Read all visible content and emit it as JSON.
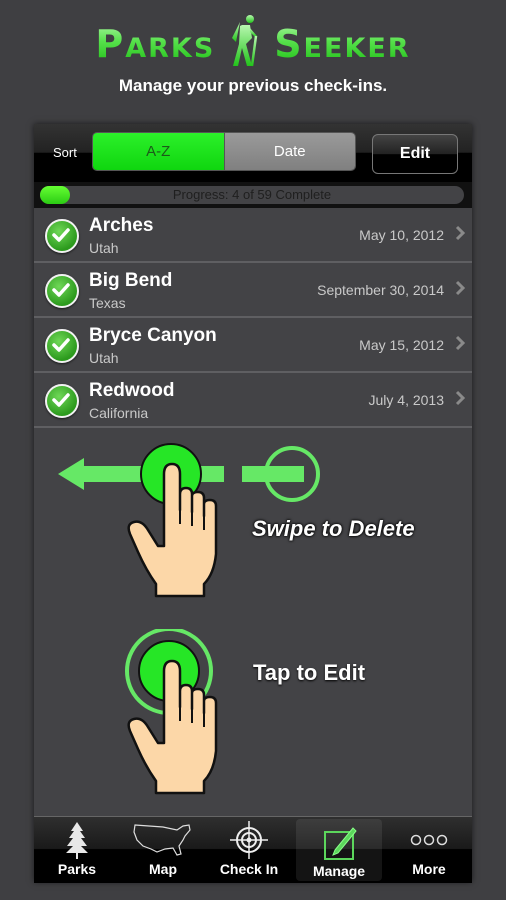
{
  "app": {
    "brand_left": "Parks",
    "brand_right": "Seeker",
    "subtitle": "Manage your previous check-ins."
  },
  "toolbar": {
    "sort_label": "Sort",
    "sort_options": [
      "A-Z",
      "Date"
    ],
    "sort_selected": "A-Z",
    "edit_label": "Edit"
  },
  "progress": {
    "text": "Progress: 4 of 59 Complete",
    "completed": 4,
    "total": 59
  },
  "checkins": [
    {
      "name": "Arches",
      "state": "Utah",
      "date": "May 10, 2012"
    },
    {
      "name": "Big Bend",
      "state": "Texas",
      "date": "September 30, 2014"
    },
    {
      "name": "Bryce Canyon",
      "state": "Utah",
      "date": "May 15, 2012"
    },
    {
      "name": "Redwood",
      "state": "California",
      "date": "July 4, 2013"
    }
  ],
  "hints": {
    "swipe": "Swipe to Delete",
    "tap": "Tap to Edit"
  },
  "tabs": [
    {
      "label": "Parks",
      "icon": "tree-icon"
    },
    {
      "label": "Map",
      "icon": "usa-map-icon"
    },
    {
      "label": "Check In",
      "icon": "crosshair-icon"
    },
    {
      "label": "Manage",
      "icon": "edit-pencil-icon",
      "selected": true
    },
    {
      "label": "More",
      "icon": "more-dots-icon"
    }
  ],
  "colors": {
    "accent_green": "#0fd60f",
    "background": "#3f3f42",
    "panel": "#434346"
  }
}
